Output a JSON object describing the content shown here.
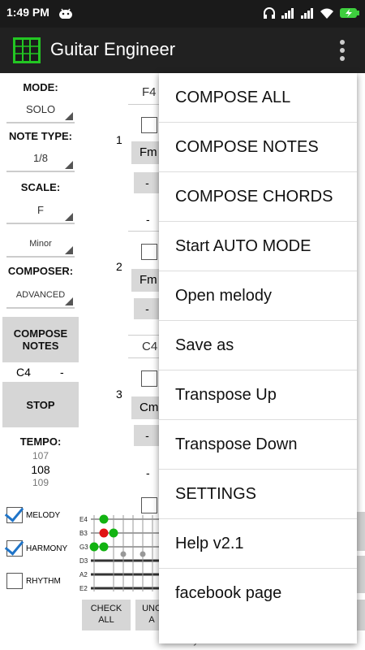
{
  "status": {
    "time": "1:49 PM"
  },
  "app": {
    "title": "Guitar Engineer",
    "icon": "guitar-fretboard-icon",
    "accent": "#23c623"
  },
  "left": {
    "mode_label": "MODE:",
    "mode_value": "SOLO",
    "note_type_label": "NOTE TYPE:",
    "note_type_value": "1/8",
    "scale_label": "SCALE:",
    "scale_value": "F",
    "scale_mode_value": "Minor",
    "composer_label": "COMPOSER:",
    "composer_value": "ADVANCED",
    "compose_notes_line1": "COMPOSE",
    "compose_notes_line2": "NOTES",
    "current_note": "C4",
    "current_note_dash": "-",
    "stop_label": "STOP",
    "tempo_label": "TEMPO:",
    "tempo_prev": "107",
    "tempo_current": "108",
    "tempo_next": "109",
    "melody_label": "MELODY",
    "melody_checked": true,
    "harmony_label": "HARMONY",
    "harmony_checked": true,
    "rhythm_label": "RHYTHM",
    "rhythm_checked": false
  },
  "middle": {
    "rows": [
      {
        "number": "1",
        "note": "F4",
        "chord": "Fm",
        "minus": "-",
        "dash": "-"
      },
      {
        "number": "2",
        "chord": "Fm",
        "minus": "-",
        "note_below": "C4"
      },
      {
        "number": "3",
        "chord": "Cm",
        "minus": "-",
        "dash": "-"
      }
    ]
  },
  "fretboard": {
    "strings": [
      "E4",
      "B3",
      "G3",
      "D3",
      "A2",
      "E2"
    ],
    "green_dot": "#12b312",
    "red_dot": "#e01414"
  },
  "bottom": {
    "check_all_line1": "CHECK",
    "check_all_line2": "ALL",
    "uncheck_line1": "UNC",
    "uncheck_line2": "A"
  },
  "menu": {
    "items": [
      "COMPOSE ALL",
      "COMPOSE NOTES",
      "COMPOSE CHORDS",
      "Start AUTO MODE",
      "Open melody",
      "Save as",
      "Transpose Up",
      "Transpose Down",
      "SETTINGS",
      "Help v2.1",
      "facebook page"
    ]
  },
  "footer": {
    "text": "Gyokov Solutions"
  }
}
